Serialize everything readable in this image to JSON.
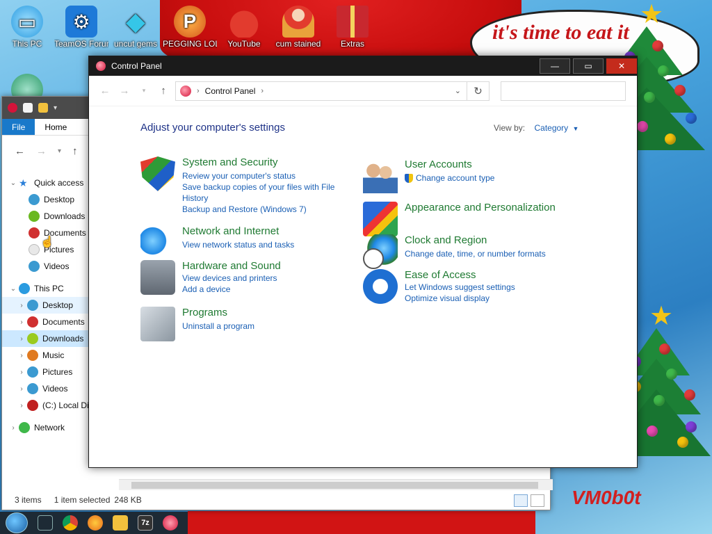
{
  "desktop": {
    "bubble_text": "it's time to eat it",
    "signature": "VM0b0t",
    "icons": [
      {
        "label": "This PC",
        "icon": "monitor-icon",
        "color": "#2a9be0"
      },
      {
        "label": "TeamOS Forum",
        "icon": "gear-icon",
        "color": "#1e7ad8"
      },
      {
        "label": "uncut gems",
        "icon": "diamond-icon",
        "color": "#35c6e8"
      },
      {
        "label": "PEGGING LOL",
        "icon": "pegging-app-icon",
        "color": "#f08a1c"
      },
      {
        "label": "YouTube",
        "icon": "angry-bird-icon",
        "color": "#d8322e"
      },
      {
        "label": "cum stained",
        "icon": "santa-figure-icon",
        "color": "#e9a23b"
      },
      {
        "label": "Extras",
        "icon": "gift-box-icon",
        "color": "#c8282f"
      }
    ]
  },
  "explorer": {
    "ribbon_tabs": [
      "File",
      "Home"
    ],
    "quick_access": {
      "label": "Quick access",
      "items": [
        {
          "label": "Desktop",
          "color": "#3b9ad1"
        },
        {
          "label": "Downloads",
          "color": "#6ab820"
        },
        {
          "label": "Documents",
          "color": "#d03030"
        },
        {
          "label": "Pictures",
          "color": "#e8e8e8"
        },
        {
          "label": "Videos",
          "color": "#3b9ad1"
        }
      ]
    },
    "this_pc": {
      "label": "This PC",
      "items": [
        {
          "label": "Desktop",
          "color": "#3b9ad1"
        },
        {
          "label": "Documents",
          "color": "#d03030"
        },
        {
          "label": "Downloads",
          "color": "#9acb20"
        },
        {
          "label": "Music",
          "color": "#e07a20"
        },
        {
          "label": "Pictures",
          "color": "#3b9ad1"
        },
        {
          "label": "Videos",
          "color": "#3b9ad1"
        },
        {
          "label": "(C:) Local Di",
          "color": "#c02020"
        }
      ]
    },
    "network_label": "Network",
    "status": {
      "items": "3 items",
      "selected": "1 item selected",
      "size": "248 KB"
    }
  },
  "control_panel": {
    "title": "Control Panel",
    "breadcrumb": "Control Panel",
    "search_placeholder": "",
    "heading": "Adjust your computer's settings",
    "view_by_label": "View by:",
    "view_by_value": "Category",
    "left_categories": [
      {
        "title": "System and Security",
        "icon": "security-shield-icon",
        "links": [
          "Review your computer's status",
          "Save backup copies of your files with File History",
          "Backup and Restore (Windows 7)"
        ]
      },
      {
        "title": "Network and Internet",
        "icon": "network-globe-icon",
        "links": [
          "View network status and tasks"
        ]
      },
      {
        "title": "Hardware and Sound",
        "icon": "printer-speaker-icon",
        "links": [
          "View devices and printers",
          "Add a device"
        ]
      },
      {
        "title": "Programs",
        "icon": "programs-disc-icon",
        "links": [
          "Uninstall a program"
        ]
      }
    ],
    "right_categories": [
      {
        "title": "User Accounts",
        "icon": "users-icon",
        "links": [
          "Change account type"
        ]
      },
      {
        "title": "Appearance and Personalization",
        "icon": "appearance-icon",
        "links": []
      },
      {
        "title": "Clock and Region",
        "icon": "clock-globe-icon",
        "links": [
          "Change date, time, or number formats"
        ]
      },
      {
        "title": "Ease of Access",
        "icon": "ease-of-access-icon",
        "links": [
          "Let Windows suggest settings",
          "Optimize visual display"
        ]
      }
    ]
  },
  "taskbar": {
    "items": [
      {
        "icon": "start-button-icon"
      },
      {
        "icon": "task-view-icon"
      },
      {
        "icon": "chrome-icon",
        "color": "#e8b31c"
      },
      {
        "icon": "firefox-icon",
        "color": "#e86a1c"
      },
      {
        "icon": "file-explorer-icon",
        "color": "#f2c13d"
      },
      {
        "icon": "7zip-icon",
        "label": "7z",
        "color": "#333333"
      },
      {
        "icon": "control-panel-icon",
        "color": "#d4143a"
      }
    ]
  }
}
